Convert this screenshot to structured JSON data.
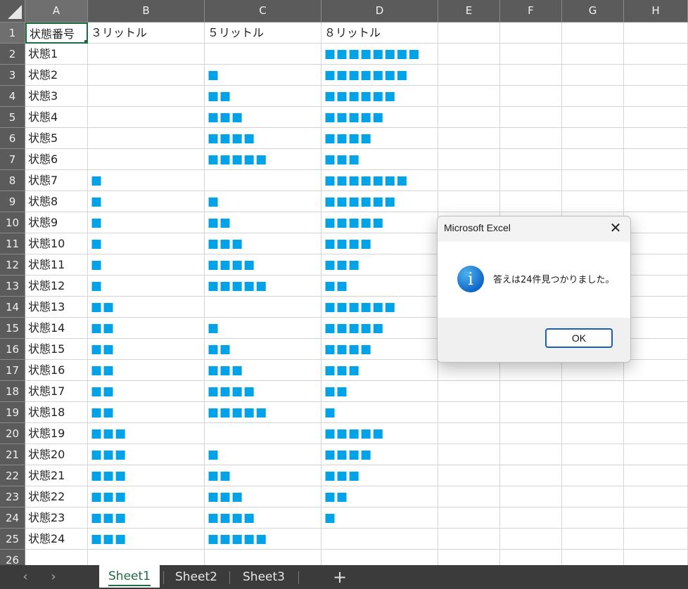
{
  "columns": [
    "A",
    "B",
    "C",
    "D",
    "E",
    "F",
    "G",
    "H"
  ],
  "rows": [
    "1",
    "2",
    "3",
    "4",
    "5",
    "6",
    "7",
    "8",
    "9",
    "10",
    "11",
    "12",
    "13",
    "14",
    "15",
    "16",
    "17",
    "18",
    "19",
    "20",
    "21",
    "22",
    "23",
    "24",
    "25",
    "26"
  ],
  "header_row": [
    "状態番号",
    "３リットル",
    "５リットル",
    "８リットル"
  ],
  "data_rows": [
    [
      "状態1",
      "",
      "",
      "■■■■■■■■"
    ],
    [
      "状態2",
      "",
      "■",
      "■■■■■■■"
    ],
    [
      "状態3",
      "",
      "■■",
      "■■■■■■"
    ],
    [
      "状態4",
      "",
      "■■■",
      "■■■■■"
    ],
    [
      "状態5",
      "",
      "■■■■",
      "■■■■"
    ],
    [
      "状態6",
      "",
      "■■■■■",
      "■■■"
    ],
    [
      "状態7",
      "■",
      "",
      "■■■■■■■"
    ],
    [
      "状態8",
      "■",
      "■",
      "■■■■■■"
    ],
    [
      "状態9",
      "■",
      "■■",
      "■■■■■"
    ],
    [
      "状態10",
      "■",
      "■■■",
      "■■■■"
    ],
    [
      "状態11",
      "■",
      "■■■■",
      "■■■"
    ],
    [
      "状態12",
      "■",
      "■■■■■",
      "■■"
    ],
    [
      "状態13",
      "■■",
      "",
      "■■■■■■"
    ],
    [
      "状態14",
      "■■",
      "■",
      "■■■■■"
    ],
    [
      "状態15",
      "■■",
      "■■",
      "■■■■"
    ],
    [
      "状態16",
      "■■",
      "■■■",
      "■■■"
    ],
    [
      "状態17",
      "■■",
      "■■■■",
      "■■"
    ],
    [
      "状態18",
      "■■",
      "■■■■■",
      "■"
    ],
    [
      "状態19",
      "■■■",
      "",
      "■■■■■"
    ],
    [
      "状態20",
      "■■■",
      "■",
      "■■■■"
    ],
    [
      "状態21",
      "■■■",
      "■■",
      "■■■"
    ],
    [
      "状態22",
      "■■■",
      "■■■",
      "■■"
    ],
    [
      "状態23",
      "■■■",
      "■■■■",
      "■"
    ],
    [
      "状態24",
      "■■■",
      "■■■■■",
      ""
    ]
  ],
  "tabs": [
    "Sheet1",
    "Sheet2",
    "Sheet3"
  ],
  "tab_nav": {
    "prev": "‹",
    "next": "›",
    "add": "+"
  },
  "dialog": {
    "title": "Microsoft Excel",
    "close_glyph": "✕",
    "icon_glyph": "i",
    "message": "答えは24件見つかりました。",
    "ok_label": "OK"
  },
  "icons": {
    "info": "info-icon",
    "close": "close-icon",
    "select_all": "select-all-icon"
  },
  "colors": {
    "block": "#00a2e8",
    "header_bg": "#5b5b5b",
    "tabbar_bg": "#3b3b3b",
    "active_green": "#1e6b41"
  }
}
